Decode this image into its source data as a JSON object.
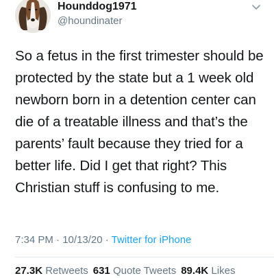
{
  "author": {
    "display_name": "Hounddog1971",
    "handle": "@houndinater",
    "avatar_icon": "basset-hound-avatar-icon"
  },
  "menu_icon": "chevron-down-icon",
  "tweet": {
    "text": "So a fetus in the first trimester should be protected by the state but a 1 week old newborn born in a detention center can die of a treatable illness and that’s the parents’ fault because they tried for a better life. Did I get that right? This Christian stuff is confusing to me."
  },
  "meta": {
    "time": "7:34 PM",
    "separator": " · ",
    "date": "10/13/20",
    "source": "Twitter for iPhone"
  },
  "stats": {
    "retweets_count": "27.3K",
    "retweets_label": "Retweets",
    "quote_count": "631",
    "quote_label": "Quote Tweets",
    "likes_count": "89.4K",
    "likes_label": "Likes"
  },
  "colors": {
    "text": "#14171a",
    "secondary": "#657786",
    "link": "#1da1f2",
    "divider": "#e1e8ed"
  }
}
